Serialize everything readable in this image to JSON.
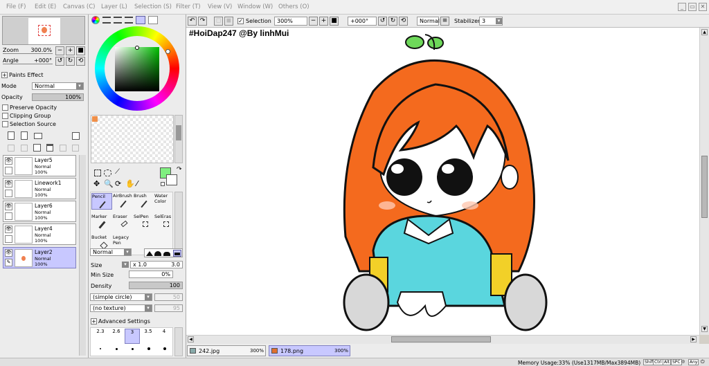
{
  "menu": {
    "items": [
      "File (F)",
      "Edit (E)",
      "Canvas (C)",
      "Layer (L)",
      "Selection (S)",
      "Filter (T)",
      "View (V)",
      "Window (W)",
      "Others (O)"
    ]
  },
  "window": {
    "minimize": "_",
    "restore": "▭",
    "close": "✕"
  },
  "navigator": {
    "zoom_label": "Zoom",
    "zoom_value": "300.0%",
    "angle_label": "Angle",
    "angle_value": "+000°"
  },
  "layer_props": {
    "paints_effect": "Paints Effect",
    "mode_label": "Mode",
    "mode_value": "Normal",
    "opacity_label": "Opacity",
    "opacity_value": "100%",
    "preserve_opacity": "Preserve Opacity",
    "clipping_group": "Clipping Group",
    "selection_source": "Selection Source"
  },
  "layers": [
    {
      "name": "Layer5",
      "mode": "Normal",
      "opacity": "100%",
      "selected": false
    },
    {
      "name": "Linework1",
      "mode": "Normal",
      "opacity": "100%",
      "selected": false
    },
    {
      "name": "Layer6",
      "mode": "Normal",
      "opacity": "100%",
      "selected": false
    },
    {
      "name": "Layer4",
      "mode": "Normal",
      "opacity": "100%",
      "selected": false
    },
    {
      "name": "Layer2",
      "mode": "Normal",
      "opacity": "100%",
      "selected": true
    }
  ],
  "colors": {
    "primary": "#80f080",
    "secondary": "#ffffff",
    "swatch": "#f0904a",
    "selected_tool_bg": "#c8c8ff"
  },
  "tools": [
    {
      "label": "Pencil",
      "selected": true
    },
    {
      "label": "AirBrush",
      "selected": false
    },
    {
      "label": "Brush",
      "selected": false
    },
    {
      "label": "Water Color",
      "selected": false
    },
    {
      "label": "Marker",
      "selected": false
    },
    {
      "label": "Eraser",
      "selected": false
    },
    {
      "label": "SelPen",
      "selected": false
    },
    {
      "label": "SelEras",
      "selected": false
    },
    {
      "label": "Bucket",
      "selected": false
    },
    {
      "label": "Legacy Pen",
      "selected": false
    }
  ],
  "brush": {
    "blend_mode": "Normal",
    "size_label": "Size",
    "size_mult": "x 1.0",
    "size_value": "3.0",
    "min_size_label": "Min Size",
    "min_size_value": "0%",
    "density_label": "Density",
    "density_value": "100",
    "shape": "(simple circle)",
    "shape_value": "50",
    "texture": "(no texture)",
    "texture_value": "95",
    "advanced": "Advanced Settings",
    "size_presets": [
      "2.3",
      "2.6",
      "3",
      "3.5",
      "4"
    ]
  },
  "toolbar": {
    "selection_label": "Selection",
    "zoom": "300%",
    "angle": "+000°",
    "mode": "Normal",
    "stabilizer_label": "Stabilizer",
    "stabilizer_value": "3"
  },
  "canvas": {
    "watermark": "#HoiDap247 @By linhMui"
  },
  "tabs": [
    {
      "name": "242.jpg",
      "zoom": "300%",
      "active": false
    },
    {
      "name": "178.png",
      "zoom": "300%",
      "active": true
    }
  ],
  "status": {
    "memory": "Memory Usage:33% (Use1317MB/Max3894MB)",
    "keys": [
      "Shift",
      "Ctrl",
      "Alt",
      "SPC",
      "◎",
      "Any",
      "⏻"
    ]
  }
}
